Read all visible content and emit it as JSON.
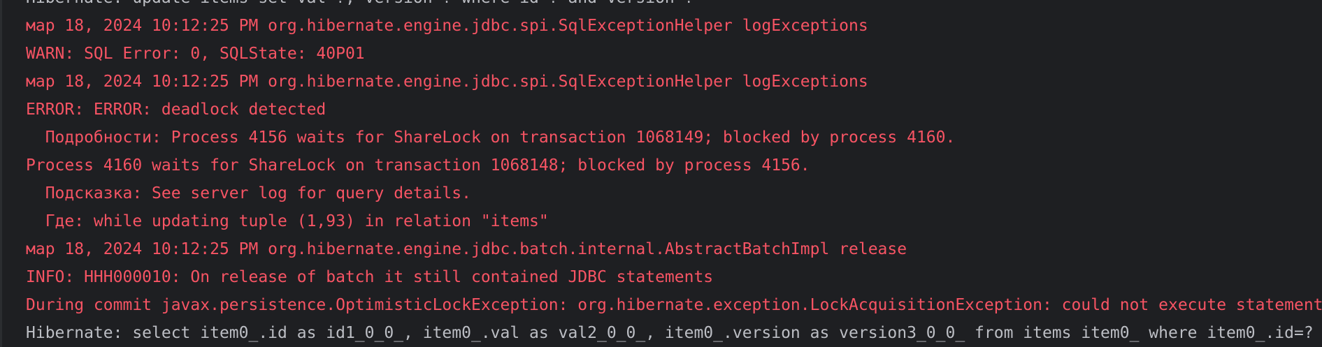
{
  "console": {
    "lines": [
      {
        "text": "Hibernate: update items set val=?, version=? where id=? and version=?",
        "kind": "out"
      },
      {
        "text": "мар 18, 2024 10:12:25 PM org.hibernate.engine.jdbc.spi.SqlExceptionHelper logExceptions",
        "kind": "err"
      },
      {
        "text": "WARN: SQL Error: 0, SQLState: 40P01",
        "kind": "err"
      },
      {
        "text": "мар 18, 2024 10:12:25 PM org.hibernate.engine.jdbc.spi.SqlExceptionHelper logExceptions",
        "kind": "err"
      },
      {
        "text": "ERROR: ERROR: deadlock detected",
        "kind": "err"
      },
      {
        "text": "  Подробности: Process 4156 waits for ShareLock on transaction 1068149; blocked by process 4160.",
        "kind": "err"
      },
      {
        "text": "Process 4160 waits for ShareLock on transaction 1068148; blocked by process 4156.",
        "kind": "err"
      },
      {
        "text": "  Подсказка: See server log for query details.",
        "kind": "err"
      },
      {
        "text": "  Где: while updating tuple (1,93) in relation \"items\"",
        "kind": "err"
      },
      {
        "text": "мар 18, 2024 10:12:25 PM org.hibernate.engine.jdbc.batch.internal.AbstractBatchImpl release",
        "kind": "err"
      },
      {
        "text": "INFO: HHH000010: On release of batch it still contained JDBC statements",
        "kind": "err"
      },
      {
        "text": "During commit javax.persistence.OptimisticLockException: org.hibernate.exception.LockAcquisitionException: could not execute statement",
        "kind": "err"
      },
      {
        "text": "Hibernate: select item0_.id as id1_0_0_, item0_.val as val2_0_0_, item0_.version as version3_0_0_ from items item0_ where item0_.id=?",
        "kind": "out"
      }
    ]
  }
}
